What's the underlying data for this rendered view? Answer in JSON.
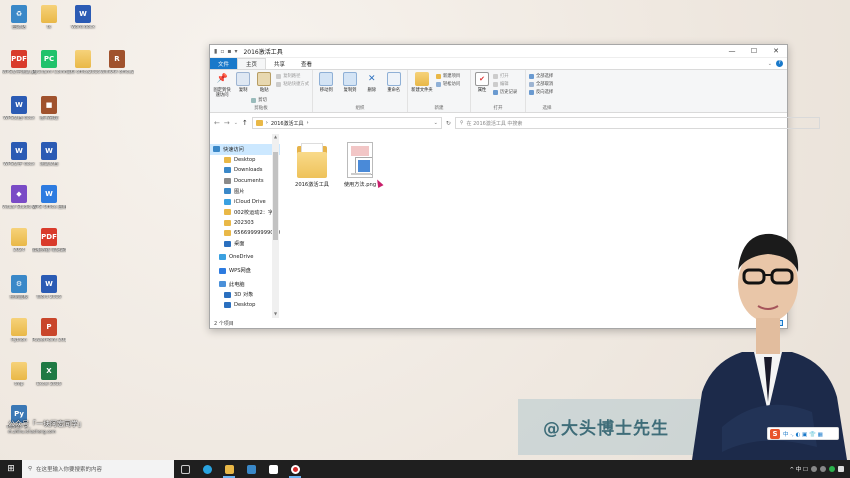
{
  "desktop": {
    "icons": [
      {
        "label": "回收站",
        "type": "recycle",
        "glyph": "♻"
      },
      {
        "label": "ts",
        "type": "folder",
        "glyph": ""
      },
      {
        "label": "Word.docx",
        "type": "word",
        "glyph": "W"
      },
      {
        "label": "WPS文字测试.pdf",
        "type": "pdf",
        "glyph": "PDF"
      },
      {
        "label": "PyCharm Commun...",
        "type": "pyc",
        "glyph": "PC"
      },
      {
        "label": "资料 office2016",
        "type": "folder",
        "glyph": ""
      },
      {
        "label": "WinRAR office2016...",
        "type": "winrar",
        "glyph": "R"
      },
      {
        "label": "WPS文档 docx",
        "type": "word",
        "glyph": "W"
      },
      {
        "label": "图书管理",
        "type": "winrar",
        "glyph": "■"
      },
      {
        "label": "WPS文字 docx",
        "type": "word",
        "glyph": "W"
      },
      {
        "label": "测试文档",
        "type": "word",
        "glyph": "W"
      },
      {
        "label": "Visual Studio 2022",
        "type": "vs",
        "glyph": "◆"
      },
      {
        "label": "WPS Office 应用中心",
        "type": "wps",
        "glyph": "W"
      },
      {
        "label": "2024",
        "type": "folder",
        "glyph": ""
      },
      {
        "label": "云服务器 笔记说明.pdf",
        "type": "pdf",
        "glyph": "PDF"
      },
      {
        "label": "控制面板",
        "type": "recycle",
        "glyph": "⚙"
      },
      {
        "label": "Word 2016",
        "type": "word",
        "glyph": "W"
      },
      {
        "label": "Python",
        "type": "folder",
        "glyph": ""
      },
      {
        "label": "PowerPoint 2016",
        "type": "ppt",
        "glyph": "P"
      },
      {
        "label": "tmp",
        "type": "folder",
        "glyph": ""
      },
      {
        "label": "Excel 2016",
        "type": "xls",
        "glyph": "X"
      },
      {
        "label": "Python 3...",
        "type": "py",
        "glyph": "Py"
      }
    ],
    "watermark_line1": "公众号「一块阿宏同学」",
    "watermark_line2": "m.zhihu.ichacheng.com",
    "brand_text": "@大头博士先生",
    "ime": {
      "logo": "S",
      "items": "中 ·, ◐ ▣ 👕 ▦"
    }
  },
  "explorer": {
    "window_title": "2016激活工具",
    "controls": {
      "minimize": "—",
      "maximize": "☐",
      "close": "✕"
    },
    "tabs": {
      "file": "文件",
      "home": "主页",
      "share": "共享",
      "view": "查看"
    },
    "ribbon": {
      "clipboard": {
        "name": "剪贴板",
        "pin": "固定到快速访问",
        "copy": "复制",
        "paste": "粘贴",
        "cut": "剪切",
        "copy_path": "复制路径",
        "paste_shortcut": "粘贴快捷方式"
      },
      "organize": {
        "name": "组织",
        "move_to": "移动到",
        "copy_to": "复制到",
        "delete": "删除",
        "rename": "重命名"
      },
      "new": {
        "name": "新建",
        "new_folder": "新建文件夹",
        "new_item": "新建项目",
        "easy_access": "轻松访问"
      },
      "open": {
        "name": "打开",
        "properties": "属性",
        "open": "打开",
        "edit": "编辑",
        "history": "历史记录"
      },
      "select": {
        "name": "选择",
        "select_all": "全部选择",
        "select_none": "全部取消",
        "invert": "反向选择"
      }
    },
    "address": {
      "path_root": "›",
      "path": "2016激活工具",
      "sep": "›"
    },
    "search_placeholder": "在 2016激活工具 中搜索",
    "nav": [
      {
        "label": "快速访问",
        "kind": "star",
        "level": 0,
        "selected": true
      },
      {
        "label": "Desktop",
        "kind": "folder",
        "level": 1,
        "pin": true
      },
      {
        "label": "Downloads",
        "kind": "down",
        "level": 1,
        "pin": true
      },
      {
        "label": "Documents",
        "kind": "doc",
        "level": 1,
        "pin": true
      },
      {
        "label": "图片",
        "kind": "pic",
        "level": 1,
        "pin": true
      },
      {
        "label": "iCloud Drive",
        "kind": "cloud",
        "level": 1,
        "pin": true
      },
      {
        "label": "002校运动2：字",
        "kind": "folder",
        "level": 1
      },
      {
        "label": "202303",
        "kind": "folder",
        "level": 1
      },
      {
        "label": "65669999999010",
        "kind": "folder",
        "level": 1
      },
      {
        "label": "桌面",
        "kind": "blue",
        "level": 1
      },
      {
        "label": "OneDrive",
        "kind": "cloud",
        "level": 0,
        "gap": true
      },
      {
        "label": "WPS网盘",
        "kind": "wps",
        "level": 0,
        "gap": true
      },
      {
        "label": "此电脑",
        "kind": "pc",
        "level": 0,
        "gap": true
      },
      {
        "label": "3D 对象",
        "kind": "blue",
        "level": 1
      },
      {
        "label": "Desktop",
        "kind": "blue",
        "level": 1
      }
    ],
    "files": [
      {
        "name": "2016激活工具",
        "kind": "folder"
      },
      {
        "name": "使用方法.png",
        "kind": "image"
      }
    ],
    "status": "2 个项目"
  },
  "taskbar": {
    "search_placeholder": "在这里输入你要搜索的内容",
    "start_glyph": "⊞",
    "tray_text": "^ 中 ☐"
  },
  "colors": {
    "accent": "#1979ca",
    "folder": "#e9b847",
    "taskbar": "#1f1f1f"
  }
}
